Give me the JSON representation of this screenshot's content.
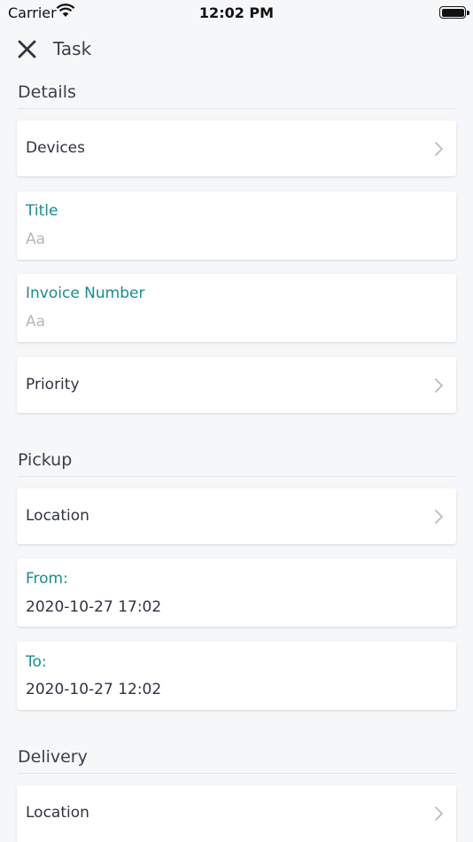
{
  "status_bar": {
    "carrier": "Carrier",
    "time": "12:02 PM"
  },
  "nav": {
    "title": "Task"
  },
  "sections": {
    "details": {
      "title": "Details",
      "devices_label": "Devices",
      "title_field": {
        "label": "Title",
        "placeholder": "Aa"
      },
      "invoice_field": {
        "label": "Invoice Number",
        "placeholder": "Aa"
      },
      "priority_label": "Priority"
    },
    "pickup": {
      "title": "Pickup",
      "location_label": "Location",
      "from": {
        "label": "From:",
        "value": "2020-10-27 17:02"
      },
      "to": {
        "label": "To:",
        "value": "2020-10-27 12:02"
      }
    },
    "delivery": {
      "title": "Delivery",
      "location_label": "Location"
    }
  },
  "colors": {
    "accent": "#178e8d",
    "background": "#f6f7f9",
    "card": "#ffffff",
    "text": "#2f3440",
    "placeholder": "#b3b7bf"
  },
  "icons": [
    "wifi-icon",
    "battery-icon",
    "close-icon",
    "chevron-right-icon"
  ]
}
